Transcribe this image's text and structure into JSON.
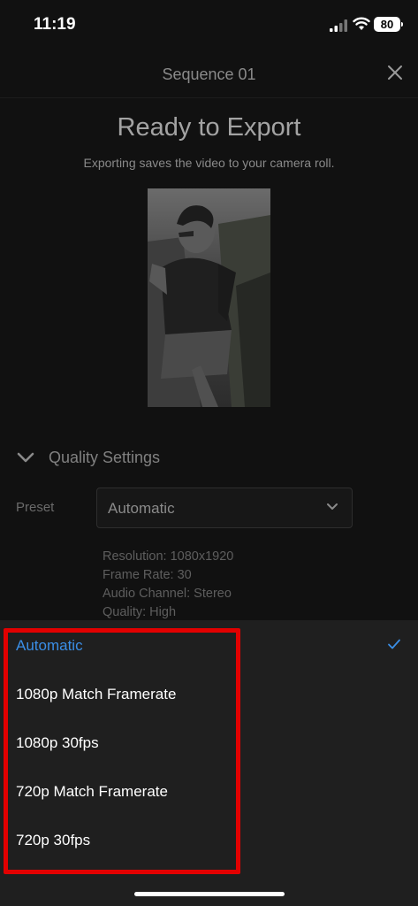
{
  "status": {
    "time": "11:19",
    "battery": "80"
  },
  "header": {
    "title": "Sequence 01"
  },
  "export": {
    "heading": "Ready to Export",
    "subheading": "Exporting saves the video to your camera roll."
  },
  "quality": {
    "label": "Quality Settings"
  },
  "preset": {
    "label": "Preset",
    "value": "Automatic"
  },
  "info": {
    "resolution": "Resolution: 1080x1920",
    "frame_rate": "Frame Rate: 30",
    "audio": "Audio Channel: Stereo",
    "quality": "Quality: High"
  },
  "options": [
    {
      "label": "Automatic",
      "selected": true
    },
    {
      "label": "1080p Match Framerate",
      "selected": false
    },
    {
      "label": "1080p 30fps",
      "selected": false
    },
    {
      "label": "720p Match Framerate",
      "selected": false
    },
    {
      "label": "720p 30fps",
      "selected": false
    }
  ],
  "colors": {
    "accent": "#3a8ee6",
    "highlight": "#e20000",
    "sheet": "#1f1f1f",
    "background": "#111111"
  }
}
